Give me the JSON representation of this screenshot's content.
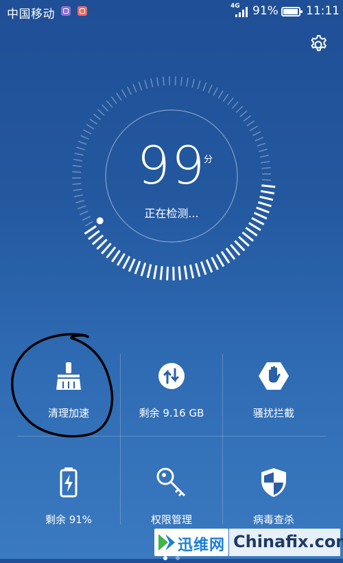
{
  "status_bar": {
    "carrier": "中国移动",
    "network_type": "4G",
    "battery_percent": "91%",
    "battery_level": 0.91,
    "time": "11:11"
  },
  "header": {
    "settings_icon": "gear-icon"
  },
  "score": {
    "value": "99",
    "unit": "分",
    "status": "正在检测...",
    "progress_fraction": 0.4
  },
  "tiles": [
    {
      "label": "清理加速",
      "icon": "broom-icon"
    },
    {
      "label": "剩余 9.16 GB",
      "icon": "up-down-arrows-icon"
    },
    {
      "label": "骚扰拦截",
      "icon": "hand-stop-icon"
    },
    {
      "label": "剩余 91%",
      "icon": "battery-charging-icon"
    },
    {
      "label": "权限管理",
      "icon": "key-icon"
    },
    {
      "label": "病毒查杀",
      "icon": "shield-icon"
    }
  ],
  "pager": {
    "pages": 2,
    "active": 0
  },
  "watermarks": {
    "left_logo_text": "迅维网",
    "right_logo_text": "Chinafix.com"
  },
  "colors": {
    "background_top": "#1f4f96",
    "background_bottom": "#3a7ac0",
    "annotation_stroke": "#000000"
  }
}
